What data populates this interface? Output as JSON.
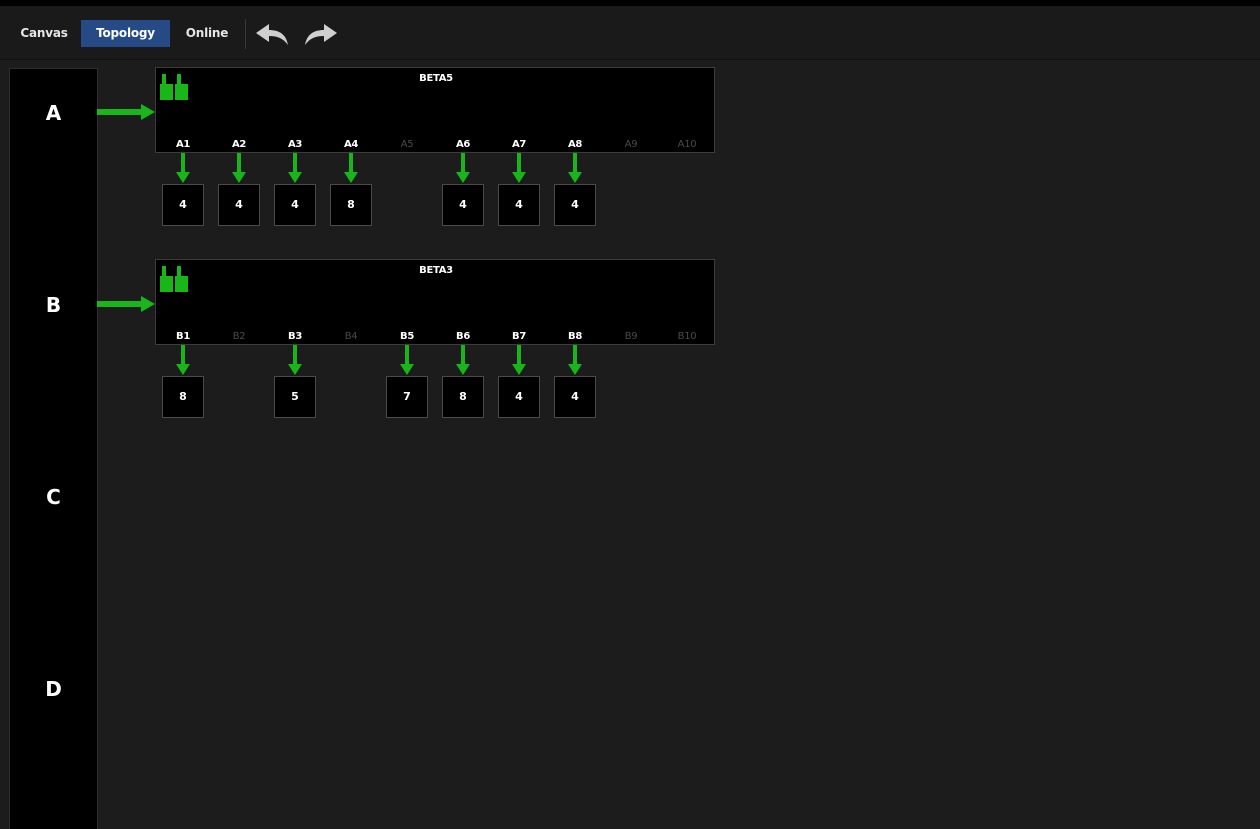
{
  "toolbar": {
    "tabs": [
      {
        "label": "Canvas",
        "active": false
      },
      {
        "label": "Topology",
        "active": true
      },
      {
        "label": "Online",
        "active": false
      }
    ],
    "undo_icon": "undo-arrow-icon",
    "redo_icon": "redo-arrow-icon"
  },
  "lanes": [
    "A",
    "B",
    "C",
    "D"
  ],
  "colors": {
    "accent": "#254a86",
    "connection": "#19b619",
    "background": "#1c1c1c"
  },
  "devices": [
    {
      "name": "BETA5",
      "lane": "A",
      "ports": [
        {
          "label": "A1",
          "active": true,
          "count": "4"
        },
        {
          "label": "A2",
          "active": true,
          "count": "4"
        },
        {
          "label": "A3",
          "active": true,
          "count": "4"
        },
        {
          "label": "A4",
          "active": true,
          "count": "8"
        },
        {
          "label": "A5",
          "active": false,
          "count": null
        },
        {
          "label": "A6",
          "active": true,
          "count": "4"
        },
        {
          "label": "A7",
          "active": true,
          "count": "4"
        },
        {
          "label": "A8",
          "active": true,
          "count": "4"
        },
        {
          "label": "A9",
          "active": false,
          "count": null
        },
        {
          "label": "A10",
          "active": false,
          "count": null
        }
      ]
    },
    {
      "name": "BETA3",
      "lane": "B",
      "ports": [
        {
          "label": "B1",
          "active": true,
          "count": "8"
        },
        {
          "label": "B2",
          "active": false,
          "count": null
        },
        {
          "label": "B3",
          "active": true,
          "count": "5"
        },
        {
          "label": "B4",
          "active": false,
          "count": null
        },
        {
          "label": "B5",
          "active": true,
          "count": "7"
        },
        {
          "label": "B6",
          "active": true,
          "count": "8"
        },
        {
          "label": "B7",
          "active": true,
          "count": "4"
        },
        {
          "label": "B8",
          "active": true,
          "count": "4"
        },
        {
          "label": "B9",
          "active": false,
          "count": null
        },
        {
          "label": "B10",
          "active": false,
          "count": null
        }
      ]
    }
  ]
}
